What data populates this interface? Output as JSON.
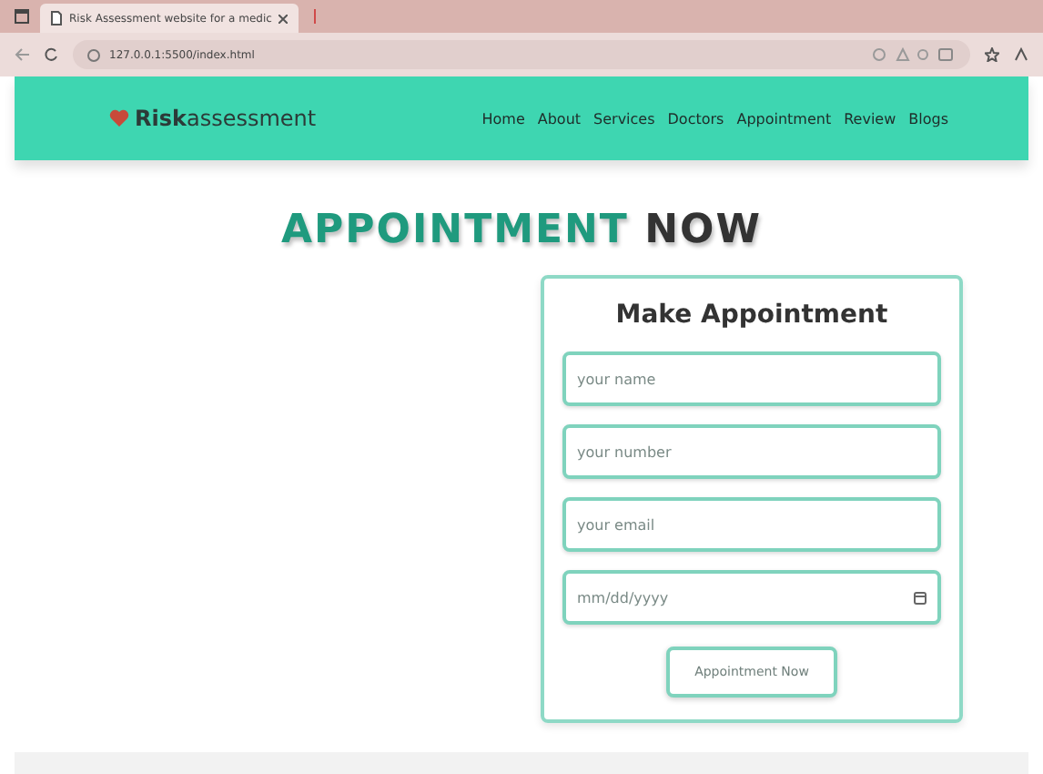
{
  "browser": {
    "tab_title": "Risk Assessment website for a medic",
    "url": "127.0.0.1:5500/index.html"
  },
  "brand": {
    "bold": "Risk",
    "rest": "assessment"
  },
  "nav": [
    {
      "label": "Home"
    },
    {
      "label": "About"
    },
    {
      "label": "Services"
    },
    {
      "label": "Doctors"
    },
    {
      "label": "Appointment"
    },
    {
      "label": "Review"
    },
    {
      "label": "Blogs"
    }
  ],
  "heading": {
    "accent": "APPOINTMENT",
    "rest": "NOW"
  },
  "form": {
    "title": "Make Appointment",
    "fields": [
      {
        "kind": "text",
        "placeholder": "your name"
      },
      {
        "kind": "text",
        "placeholder": "your number"
      },
      {
        "kind": "text",
        "placeholder": "your email"
      },
      {
        "kind": "date",
        "placeholder": "mm/dd/yyyy"
      }
    ],
    "submit": "Appointment Now"
  }
}
